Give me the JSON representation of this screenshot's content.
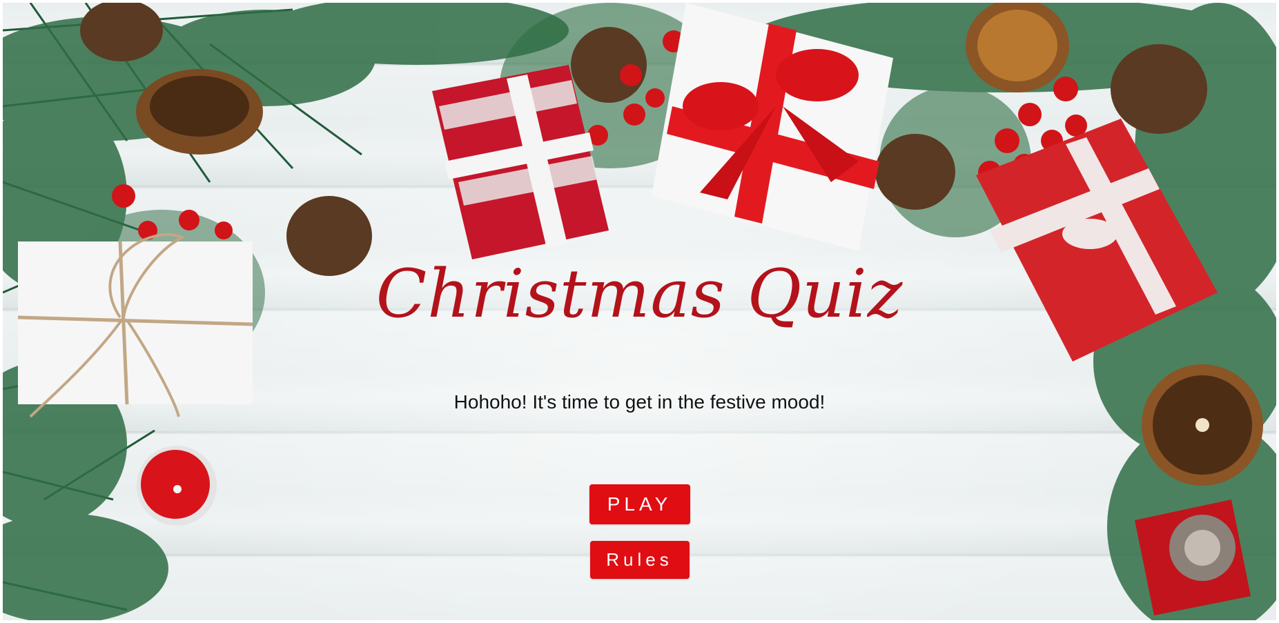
{
  "page": {
    "title": "Christmas Quiz",
    "subtitle": "Hohoho! It's time to get in the festive mood!"
  },
  "buttons": {
    "play_label": "PLAY",
    "rules_label": "Rules"
  },
  "colors": {
    "title": "#b3121b",
    "button_bg": "#e00d12",
    "button_text": "#ffffff",
    "subtitle_text": "#111111"
  },
  "background": {
    "description_icons": [
      "pine-branch-icon",
      "pinecone-icon",
      "gift-box-icon",
      "red-berries-icon",
      "dried-orange-slice-icon",
      "tealight-candle-icon"
    ]
  }
}
